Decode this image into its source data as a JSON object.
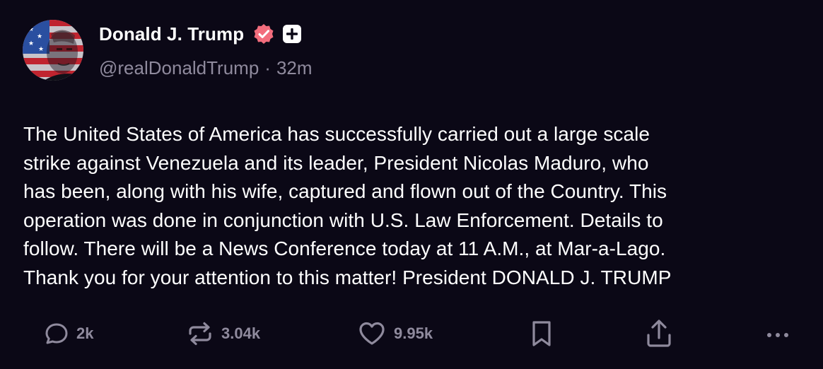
{
  "author": {
    "display_name": "Donald J. Trump",
    "handle": "@realDonaldTrump",
    "separator": "·",
    "timestamp": "32m",
    "avatar_icon": "flag-portrait-avatar",
    "verified_icon": "verified-badge-icon",
    "plus_icon": "plus-badge-icon",
    "verified_color": "#f26d7d"
  },
  "post": {
    "text": "The United States of America has successfully carried out a large scale\nstrike against Venezuela and its leader, President Nicolas Maduro, who\nhas been, along with his wife, captured and flown out of the Country. This\noperation was done in conjunction with U.S. Law Enforcement. Details to\nfollow. There will be a News Conference today at 11 A.M., at Mar-a-Lago.\nThank you for your attention to this matter! President DONALD J. TRUMP"
  },
  "actions": {
    "reply_count": "2k",
    "repost_count": "3.04k",
    "like_count": "9.95k",
    "reply_icon": "reply-icon",
    "repost_icon": "repost-icon",
    "like_icon": "heart-icon",
    "bookmark_icon": "bookmark-icon",
    "share_icon": "share-icon",
    "more_icon": "more-icon"
  },
  "colors": {
    "background": "#0b0816",
    "text_primary": "#ffffff",
    "text_secondary": "#8f8a9d"
  }
}
